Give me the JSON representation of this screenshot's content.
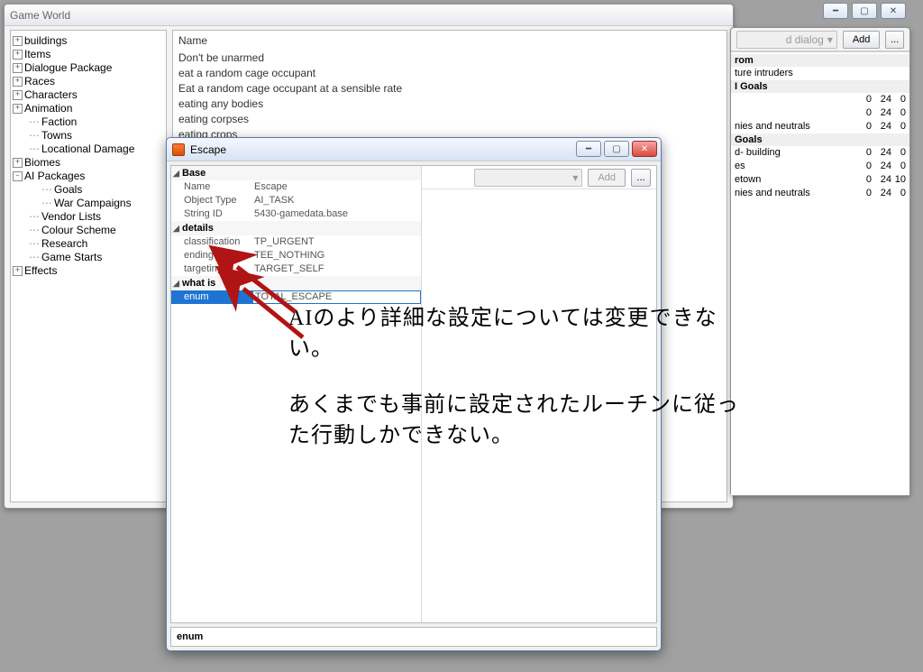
{
  "main_window": {
    "title": "Game World"
  },
  "tree": [
    {
      "exp": "+",
      "ind": 0,
      "label": "buildings"
    },
    {
      "exp": "+",
      "ind": 0,
      "label": "Items"
    },
    {
      "exp": "+",
      "ind": 0,
      "label": "Dialogue Package"
    },
    {
      "exp": "+",
      "ind": 0,
      "label": "Races"
    },
    {
      "exp": "+",
      "ind": 0,
      "label": "Characters"
    },
    {
      "exp": "+",
      "ind": 0,
      "label": "Animation"
    },
    {
      "exp": "",
      "ind": 0,
      "dots": true,
      "label": "Faction"
    },
    {
      "exp": "",
      "ind": 0,
      "dots": true,
      "label": "Towns"
    },
    {
      "exp": "",
      "ind": 0,
      "dots": true,
      "label": "Locational Damage"
    },
    {
      "exp": "+",
      "ind": 0,
      "label": "Biomes"
    },
    {
      "exp": "-",
      "ind": 0,
      "label": "AI Packages"
    },
    {
      "exp": "",
      "ind": 1,
      "dots": true,
      "label": "Goals"
    },
    {
      "exp": "",
      "ind": 1,
      "dots": true,
      "label": "War Campaigns"
    },
    {
      "exp": "",
      "ind": 0,
      "dots": true,
      "label": "Vendor Lists"
    },
    {
      "exp": "",
      "ind": 0,
      "dots": true,
      "label": "Colour Scheme"
    },
    {
      "exp": "",
      "ind": 0,
      "dots": true,
      "label": "Research"
    },
    {
      "exp": "",
      "ind": 0,
      "dots": true,
      "label": "Game Starts"
    },
    {
      "exp": "+",
      "ind": 0,
      "label": "Effects"
    }
  ],
  "list_header": "Name",
  "list_items": [
    "Don't be unarmed",
    "eat a random cage occupant",
    "Eat a random cage occupant at a sensible rate",
    "eating any bodies",
    "eating corpses",
    "eating crops"
  ],
  "right_window": {
    "combo_tail": "d dialog",
    "add_label": "Add",
    "ellipsis": "...",
    "rows": [
      {
        "cat": true,
        "label": "rom"
      },
      {
        "k": "ture intruders"
      },
      {
        "cat": true,
        "label": "I Goals"
      },
      {
        "k": "",
        "v1": "0",
        "v2": "24",
        "v3": "0"
      },
      {
        "k": "",
        "v1": "0",
        "v2": "24",
        "v3": "0"
      },
      {
        "k": "nies and neutrals",
        "v1": "0",
        "v2": "24",
        "v3": "0"
      },
      {
        "cat": true,
        "label": "Goals"
      },
      {
        "k": "d- building",
        "v1": "0",
        "v2": "24",
        "v3": "0"
      },
      {
        "k": "es",
        "v1": "0",
        "v2": "24",
        "v3": "0"
      },
      {
        "k": "etown",
        "v1": "0",
        "v2": "24",
        "v3": "10"
      },
      {
        "k": "nies and neutrals",
        "v1": "0",
        "v2": "24",
        "v3": "0"
      }
    ]
  },
  "escape_window": {
    "title": "Escape",
    "add_label": "Add",
    "ellipsis": "...",
    "status": "enum",
    "groups": [
      {
        "name": "Base",
        "rows": [
          {
            "k": "Name",
            "v": "Escape"
          },
          {
            "k": "Object Type",
            "v": "AI_TASK"
          },
          {
            "k": "String ID",
            "v": "5430-gamedata.base"
          }
        ]
      },
      {
        "name": "details",
        "rows": [
          {
            "k": "classification",
            "v": "TP_URGENT"
          },
          {
            "k": "ending",
            "v": "TEE_NOTHING"
          },
          {
            "k": "targeting",
            "v": "TARGET_SELF"
          }
        ]
      },
      {
        "name": "what is",
        "rows": [
          {
            "k": "enum",
            "v": "TOTAL_ESCAPE",
            "selected": true
          }
        ]
      }
    ]
  },
  "annotation": {
    "p1": "AIのより詳細な設定については変更できない。",
    "p2": "あくまでも事前に設定されたルーチンに従った行動しかできない。"
  }
}
